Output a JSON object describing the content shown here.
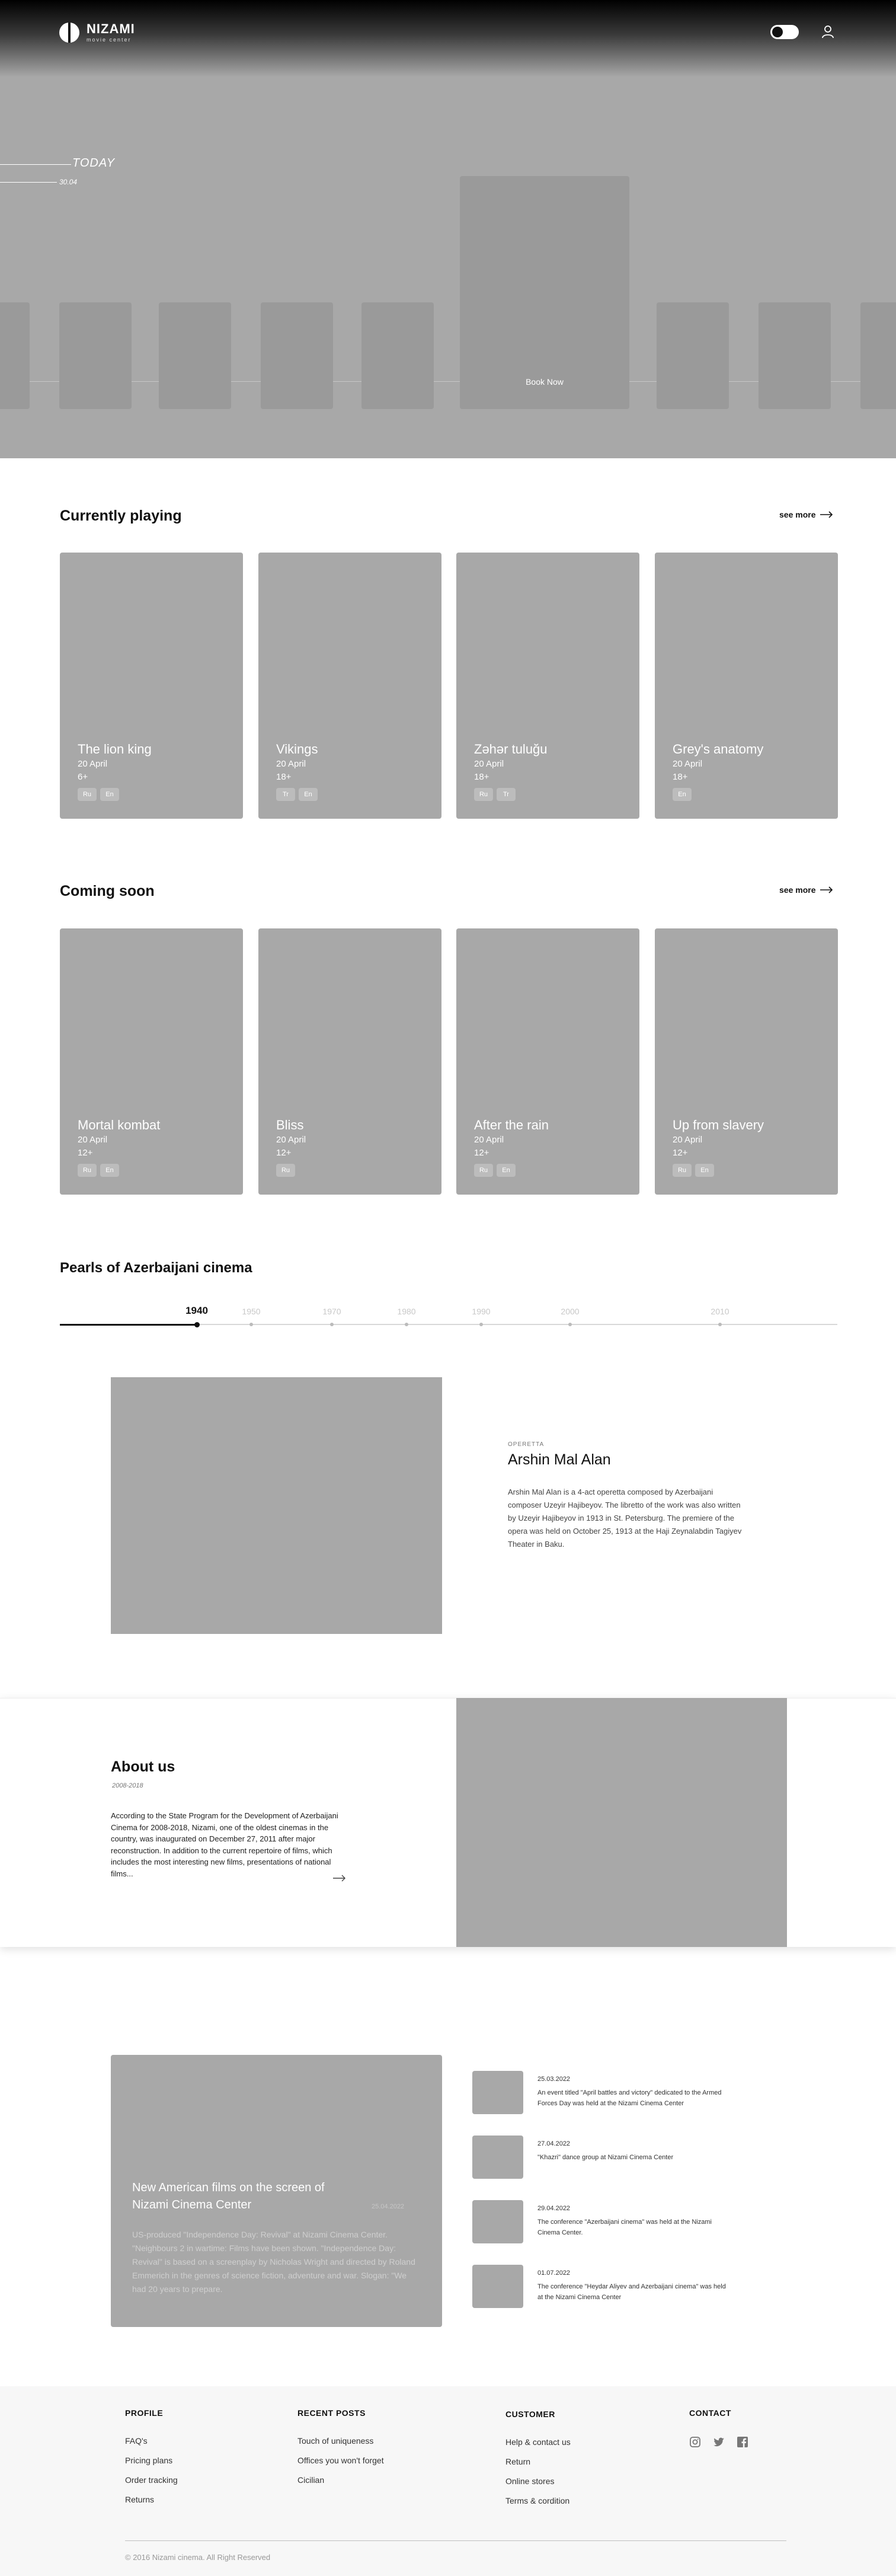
{
  "header": {
    "logo_title": "NIZAMI",
    "logo_subtitle": "movie center",
    "today_label": "TODAY",
    "today_date": "30.04",
    "book_now_label": "Book Now"
  },
  "currently_playing": {
    "title": "Currently playing",
    "see_more": "see more",
    "movies": [
      {
        "title": "The lion king",
        "date": "20 April",
        "age": "6+",
        "langs": [
          "Ru",
          "En"
        ]
      },
      {
        "title": "Vikings",
        "date": "20 April",
        "age": "18+",
        "langs": [
          "Tr",
          "En"
        ]
      },
      {
        "title": "Zəhər tuluğu",
        "date": "20 April",
        "age": "18+",
        "langs": [
          "Ru",
          "Tr"
        ]
      },
      {
        "title": "Grey's anatomy",
        "date": "20 April",
        "age": "18+",
        "langs": [
          "En"
        ]
      }
    ]
  },
  "coming_soon": {
    "title": "Coming soon",
    "see_more": "see more",
    "movies": [
      {
        "title": "Mortal kombat",
        "date": "20 April",
        "age": "12+",
        "langs": [
          "Ru",
          "En"
        ]
      },
      {
        "title": "Bliss",
        "date": "20 April",
        "age": "12+",
        "langs": [
          "Ru"
        ]
      },
      {
        "title": "After the rain",
        "date": "20 April",
        "age": "12+",
        "langs": [
          "Ru",
          "En"
        ]
      },
      {
        "title": "Up from slavery",
        "date": "20 April",
        "age": "12+",
        "langs": [
          "Ru",
          "En"
        ]
      }
    ]
  },
  "pearls": {
    "title": "Pearls of Azerbaijani cinema",
    "years": [
      "1940",
      "1950",
      "1970",
      "1980",
      "1990",
      "2000",
      "2010"
    ],
    "active_year": "1940",
    "category": "OPERETTA",
    "item_title": "Arshin Mal Alan",
    "item_text": "Arshin Mal Alan is a 4-act operetta composed by Azerbaijani composer Uzeyir Hajibeyov. The libretto of the work was also written by Uzeyir Hajibeyov in 1913 in St. Petersburg. The premiere of the opera was held on October 25, 1913 at the Haji Zeynalabdin Tagiyev Theater in Baku."
  },
  "about": {
    "title": "About us",
    "years": "2008-2018",
    "text": "According to the State Program for the Development of Azerbaijani Cinema for 2008-2018, Nizami, one of the oldest cinemas in the country, was inaugurated on December 27, 2011 after major reconstruction. In addition to the current repertoire of films, which includes the most interesting new films, presentations of national films..."
  },
  "news": {
    "main": {
      "title": "New American films on the screen of Nizami Cinema Center",
      "date": "25.04.2022",
      "text": "US-produced \"Independence Day: Revival\" at Nizami Cinema Center. \"Neighbours 2 in wartime: Films have been shown. \"Independence Day: Revival\" is based on a screenplay by Nicholas Wright and directed by Roland Emmerich in the genres of science fiction, adventure and war. Slogan: \"We had 20 years to prepare."
    },
    "items": [
      {
        "date": "25.03.2022",
        "text": "An event titled \"April battles and victory\" dedicated to the Armed Forces Day was held at the Nizami Cinema Center"
      },
      {
        "date": "27.04.2022",
        "text": "\"Khazri\" dance group at Nizami Cinema Center"
      },
      {
        "date": "29.04.2022",
        "text": "The conference \"Azerbaijani cinema\" was held at the Nizami Cinema Center."
      },
      {
        "date": "01.07.2022",
        "text": "The conference \"Heydar Aliyev and Azerbaijani cinema\" was held at the Nizami Cinema Center"
      }
    ]
  },
  "footer": {
    "profile": {
      "title": "PROFILE",
      "links": [
        "FAQ's",
        "Pricing plans",
        "Order tracking",
        "Returns"
      ]
    },
    "recent_posts": {
      "title": "RECENT POSTS",
      "links": [
        "Touch of uniqueness",
        "Offices you won't forget",
        "Cicilian"
      ]
    },
    "customer": {
      "title": "CUSTOMER",
      "links": [
        "Help & contact us",
        "Return",
        "Online stores",
        "Terms & cordition"
      ]
    },
    "contact": {
      "title": "CONTACT",
      "icons": [
        "instagram-icon",
        "twitter-icon",
        "facebook-icon"
      ]
    },
    "copyright": "© 2016 Nizami cinema. All Right Reserved"
  }
}
